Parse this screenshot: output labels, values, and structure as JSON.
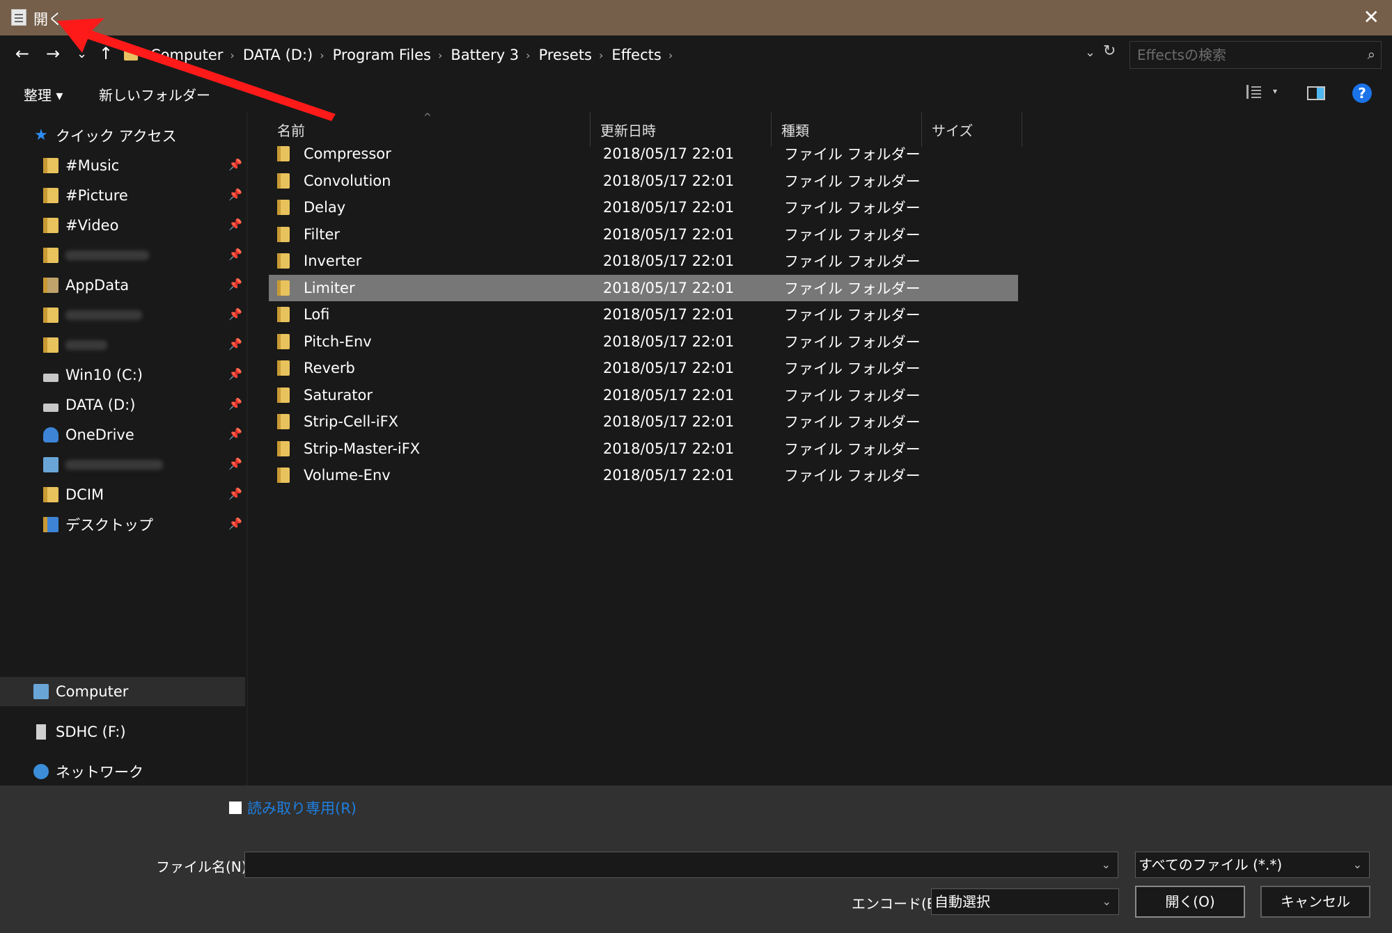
{
  "window": {
    "title": "開く",
    "close_glyph": "✕"
  },
  "address": {
    "crumbs": [
      "Computer",
      "DATA (D:)",
      "Program Files",
      "Battery 3",
      "Presets",
      "Effects"
    ],
    "search_placeholder": "Effectsの検索"
  },
  "toolbar": {
    "organize": "整理 ▾",
    "new_folder": "新しいフォルダー"
  },
  "sidebar": {
    "quick_access": "クイック アクセス",
    "items": [
      "#Music",
      "#Picture",
      "#Video",
      "AppData",
      "Win10 (C:)",
      "DATA (D:)",
      "OneDrive",
      "DCIM",
      "デスクトップ"
    ],
    "computer": "Computer",
    "sdhc": "SDHC (F:)",
    "network": "ネットワーク"
  },
  "columns": {
    "name": "名前",
    "date": "更新日時",
    "type": "種類",
    "size": "サイズ"
  },
  "files": [
    {
      "name": "Compressor",
      "date": "2018/05/17 22:01",
      "type": "ファイル フォルダー"
    },
    {
      "name": "Convolution",
      "date": "2018/05/17 22:01",
      "type": "ファイル フォルダー"
    },
    {
      "name": "Delay",
      "date": "2018/05/17 22:01",
      "type": "ファイル フォルダー"
    },
    {
      "name": "Filter",
      "date": "2018/05/17 22:01",
      "type": "ファイル フォルダー"
    },
    {
      "name": "Inverter",
      "date": "2018/05/17 22:01",
      "type": "ファイル フォルダー"
    },
    {
      "name": "Limiter",
      "date": "2018/05/17 22:01",
      "type": "ファイル フォルダー"
    },
    {
      "name": "Lofi",
      "date": "2018/05/17 22:01",
      "type": "ファイル フォルダー"
    },
    {
      "name": "Pitch-Env",
      "date": "2018/05/17 22:01",
      "type": "ファイル フォルダー"
    },
    {
      "name": "Reverb",
      "date": "2018/05/17 22:01",
      "type": "ファイル フォルダー"
    },
    {
      "name": "Saturator",
      "date": "2018/05/17 22:01",
      "type": "ファイル フォルダー"
    },
    {
      "name": "Strip-Cell-iFX",
      "date": "2018/05/17 22:01",
      "type": "ファイル フォルダー"
    },
    {
      "name": "Strip-Master-iFX",
      "date": "2018/05/17 22:01",
      "type": "ファイル フォルダー"
    },
    {
      "name": "Volume-Env",
      "date": "2018/05/17 22:01",
      "type": "ファイル フォルダー"
    }
  ],
  "selected_file": "Limiter",
  "footer": {
    "readonly": "読み取り専用(R)",
    "filename_label": "ファイル名(N):",
    "filename_value": "",
    "filter": "すべてのファイル (*.*)",
    "encode_label": "エンコード(E):",
    "encode_value": "自動選択",
    "open": "開く(O)",
    "cancel": "キャンセル"
  },
  "colors": {
    "titlebar": "#755f4a",
    "selection": "#777777",
    "accent": "#1e7fe0",
    "arrow": "#ff1a1a"
  }
}
